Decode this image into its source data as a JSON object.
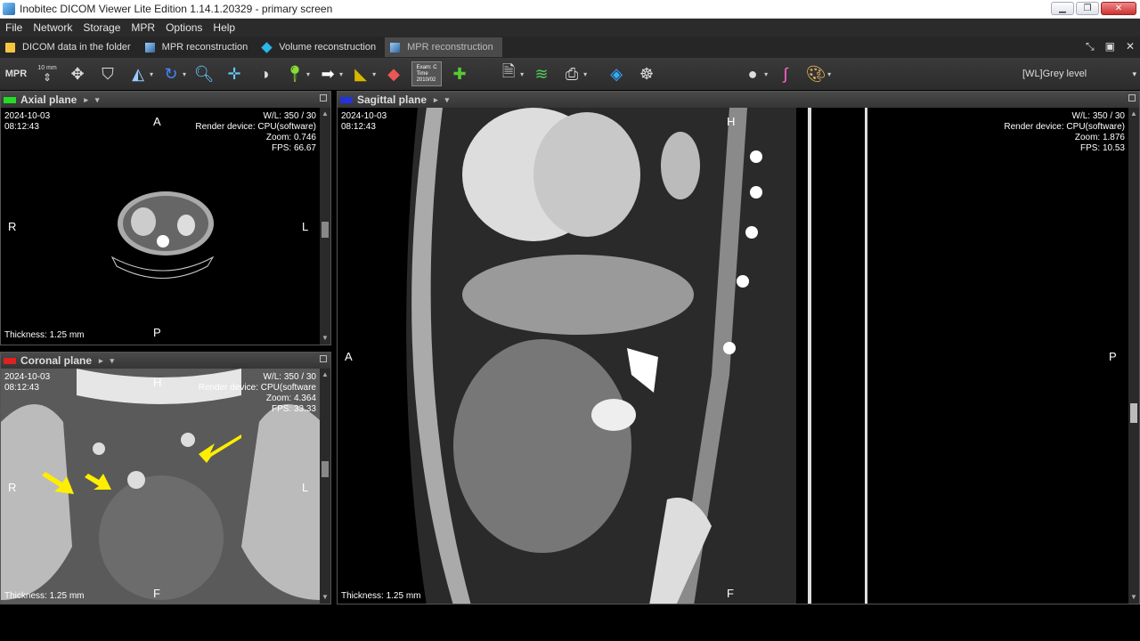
{
  "window": {
    "title": "Inobitec DICOM Viewer Lite Edition 1.14.1.20329 - primary screen"
  },
  "menu": [
    "File",
    "Network",
    "Storage",
    "MPR",
    "Options",
    "Help"
  ],
  "tabs": [
    {
      "label": "DICOM data in the folder",
      "active": false
    },
    {
      "label": "MPR reconstruction",
      "active": false
    },
    {
      "label": "Volume reconstruction",
      "active": false
    },
    {
      "label": "MPR reconstruction",
      "active": true
    }
  ],
  "toolbar": {
    "mpr_label": "MPR",
    "slab_label": "10 mm",
    "exam_icon_text": "Exam: C\nTime\n2010/02",
    "wl_preset": "[WL]Grey level"
  },
  "axial": {
    "title": "Axial plane",
    "color": "#22dd22",
    "date": "2024-10-03",
    "time": "08:12:43",
    "wl": "W/L: 350 / 30",
    "render": "Render device: CPU(software)",
    "zoom": "Zoom: 0.746",
    "fps": "FPS: 66.67",
    "thickness": "Thickness: 1.25 mm",
    "top": "A",
    "bottom": "P",
    "left": "R",
    "right": "L"
  },
  "coronal": {
    "title": "Coronal plane",
    "color": "#dd2222",
    "date": "2024-10-03",
    "time": "08:12:43",
    "wl": "W/L: 350 / 30",
    "render": "Render device: CPU(software",
    "zoom": "Zoom: 4.364",
    "fps": "FPS: 33.33",
    "thickness": "Thickness: 1.25 mm",
    "top": "H",
    "bottom": "F",
    "left": "R",
    "right": "L"
  },
  "sagittal": {
    "title": "Sagittal plane",
    "color": "#2233dd",
    "date": "2024-10-03",
    "time": "08:12:43",
    "wl": "W/L: 350 / 30",
    "render": "Render device: CPU(software)",
    "zoom": "Zoom: 1.876",
    "fps": "FPS: 10.53",
    "thickness": "Thickness: 1.25 mm",
    "top": "H",
    "bottom": "F",
    "left": "A",
    "right": "P"
  },
  "colors": {
    "annotation_arrow": "#ffee00",
    "menubar": "#2b2b2b",
    "header": "#3d3d3d"
  }
}
